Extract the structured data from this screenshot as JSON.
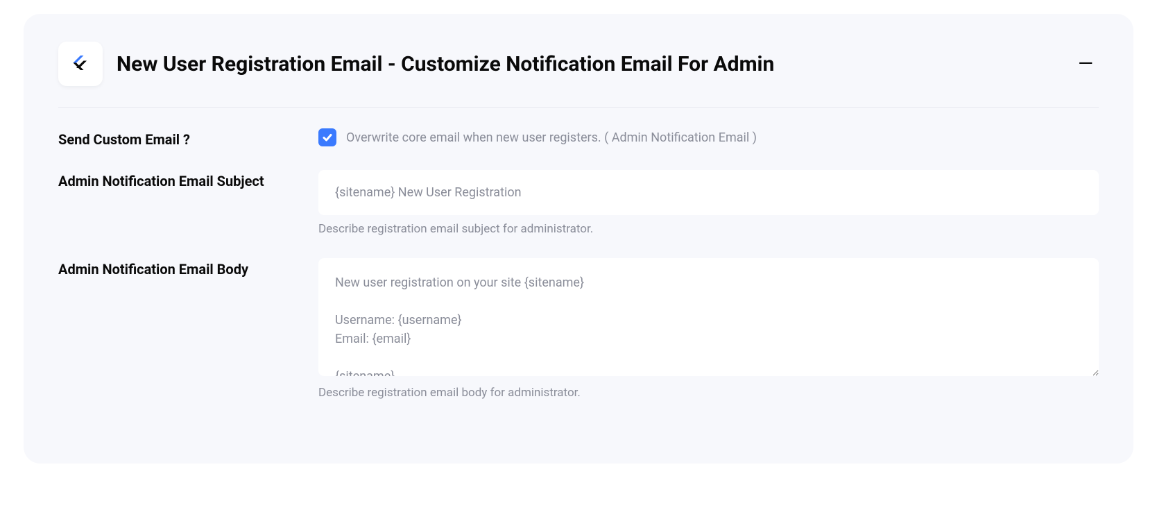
{
  "header": {
    "title": "New User Registration Email - Customize Notification Email For Admin"
  },
  "fields": {
    "send_custom_email": {
      "label": "Send Custom Email ?",
      "checkbox_label": "Overwrite core email when new user registers. ( Admin Notification Email )",
      "checked": true
    },
    "admin_subject": {
      "label": "Admin Notification Email Subject",
      "value": "{sitename} New User Registration",
      "helper": "Describe registration email subject for administrator."
    },
    "admin_body": {
      "label": "Admin Notification Email Body",
      "value": "New user registration on your site {sitename}\n\nUsername: {username}\nEmail: {email}\n\n{sitename}",
      "helper": "Describe registration email body for administrator."
    }
  },
  "colors": {
    "accent": "#3a7afe",
    "text_muted": "#8a8d99",
    "background_card": "#f7f8fc"
  }
}
